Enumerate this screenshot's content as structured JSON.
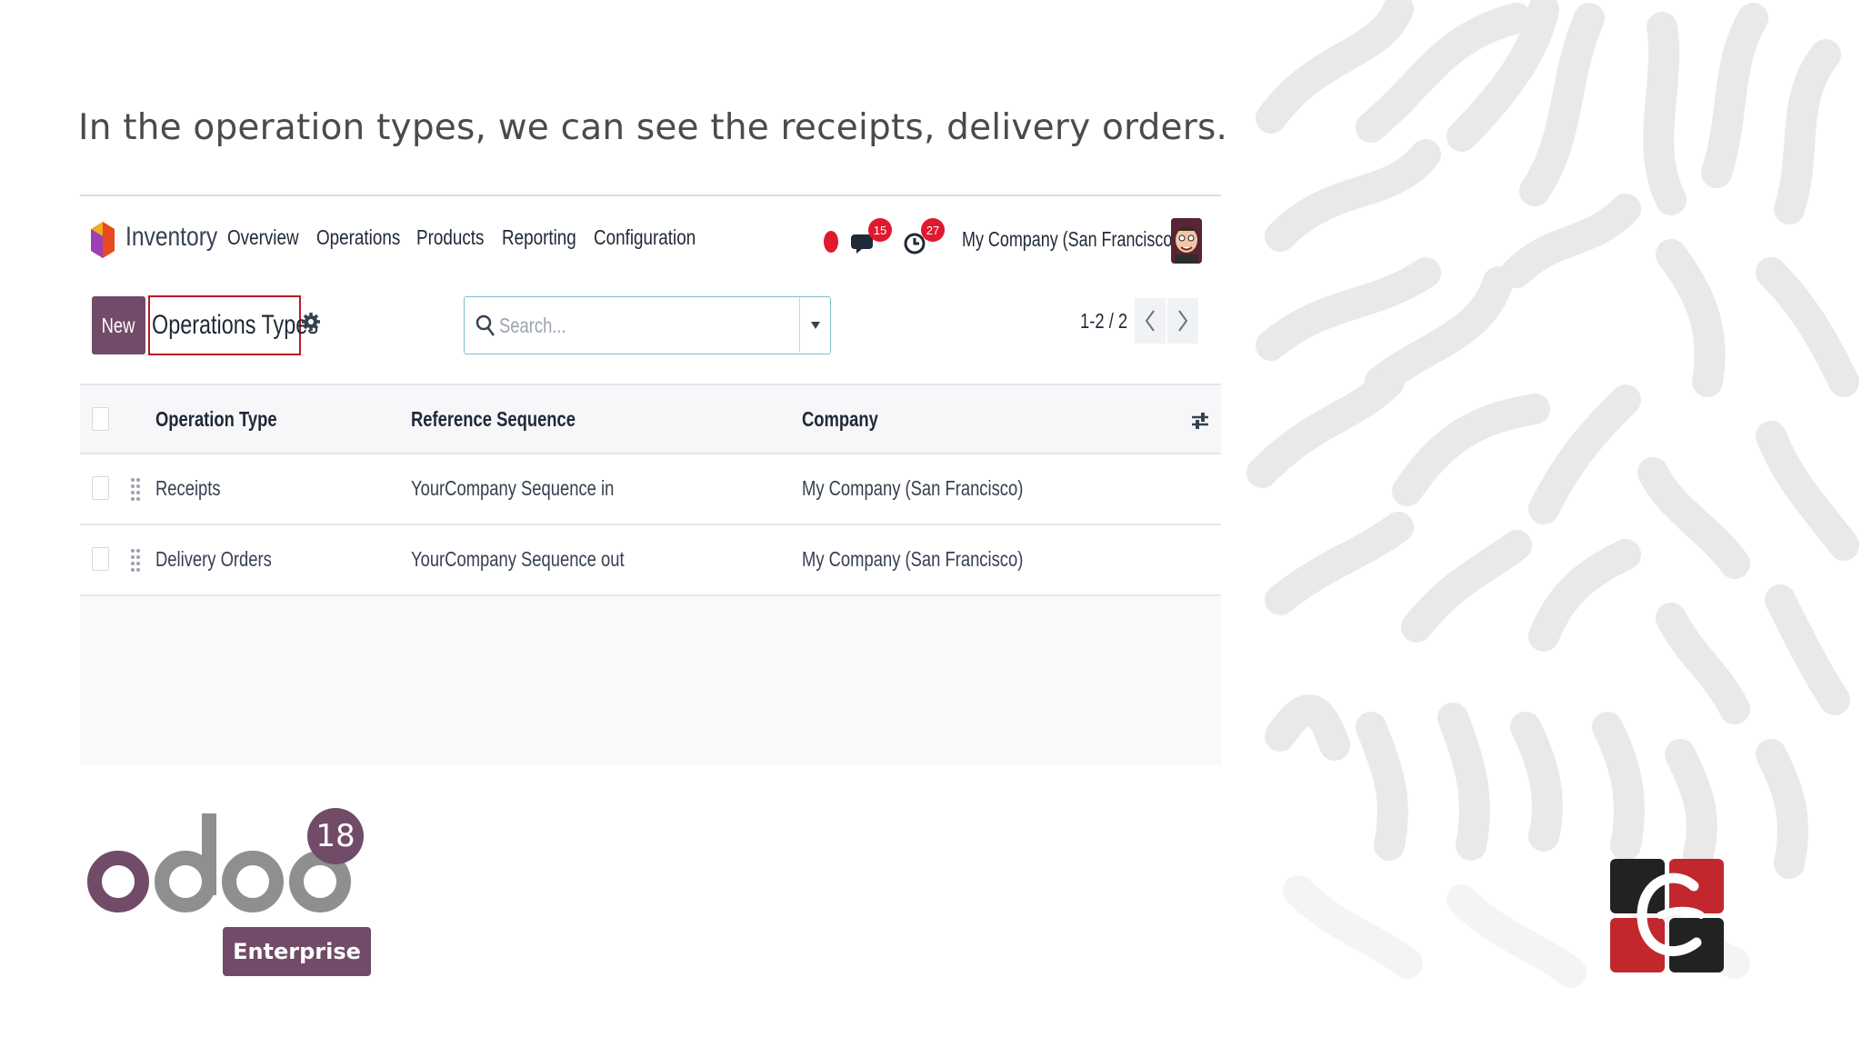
{
  "caption": "In the operation types, we can see the receipts, delivery orders.",
  "navbar": {
    "app_name": "Inventory",
    "menu": [
      "Overview",
      "Operations",
      "Products",
      "Reporting",
      "Configuration"
    ],
    "messages_count": "15",
    "activities_count": "27",
    "company": "My Company (San Francisco)"
  },
  "control": {
    "new_label": "New",
    "title": "Operations Types",
    "search_placeholder": "Search...",
    "pager": "1-2 / 2"
  },
  "table": {
    "columns": [
      "Operation Type",
      "Reference Sequence",
      "Company"
    ],
    "rows": [
      {
        "operation_type": "Receipts",
        "sequence": "YourCompany Sequence in",
        "company": "My Company (San Francisco)"
      },
      {
        "operation_type": "Delivery Orders",
        "sequence": "YourCompany Sequence out",
        "company": "My Company (San Francisco)"
      }
    ]
  },
  "branding": {
    "odoo_version": "18",
    "edition": "Enterprise"
  },
  "colors": {
    "primary": "#714b67",
    "highlight_border": "#b81c24",
    "badge": "#e0192e",
    "search_border": "#7dc0c9"
  }
}
